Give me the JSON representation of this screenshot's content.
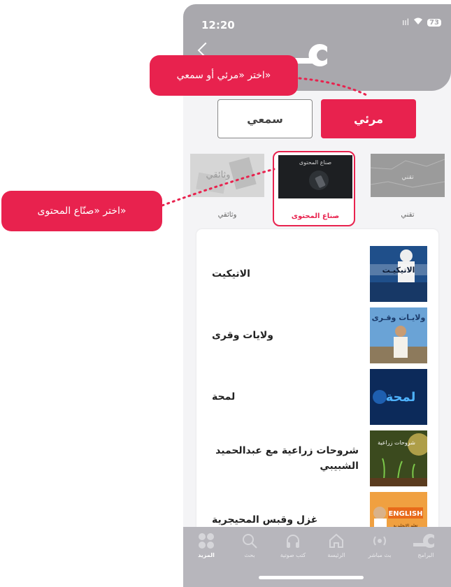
{
  "status": {
    "time": "12:20",
    "battery": "73"
  },
  "tabs": {
    "audio_label": "سمعي",
    "visual_label": "مرئي"
  },
  "categories": [
    {
      "label": "وثائقي",
      "thumb_text": "وثائقي"
    },
    {
      "label": "صناع المحتوى",
      "thumb_text": "صناع المحتوى"
    },
    {
      "label": "تقني",
      "thumb_text": "تقني"
    }
  ],
  "programs": [
    {
      "title": "الاتيكيت",
      "thumb_text": "الاتيكيـت"
    },
    {
      "title": "ولايات وقرى",
      "thumb_text": "ولايـات وقـرى"
    },
    {
      "title": "لمحة",
      "thumb_text": "لمحة"
    },
    {
      "title": "شروحات زراعية مع عبدالحميد الشبيبي",
      "thumb_text": "شروحات زراعية"
    },
    {
      "title": "غزل وقبس المحيجرية",
      "thumb_text": "ENGLISH",
      "thumb_subtext": "تعلم الإنجليزية"
    }
  ],
  "tabbar": [
    {
      "label": "المزيد",
      "icon": "more-grid-icon"
    },
    {
      "label": "بحث",
      "icon": "search-icon"
    },
    {
      "label": "كتب صوتية",
      "icon": "headphones-icon"
    },
    {
      "label": "الرئيسة",
      "icon": "home-icon"
    },
    {
      "label": "بث مباشر",
      "icon": "live-broadcast-icon"
    },
    {
      "label": "البرامج",
      "icon": "programs-logo-icon"
    }
  ],
  "callouts": {
    "choose_type": "اختر «مرئي أو سمعي»",
    "choose_creators": "اختر «صنّاع المحتوى»"
  },
  "colors": {
    "accent": "#e8224e",
    "header": "#a9a8ad",
    "tabbar": "#b7b6bc"
  }
}
